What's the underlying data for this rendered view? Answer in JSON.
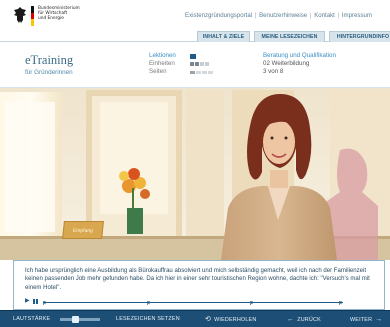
{
  "header": {
    "ministry_lines": [
      "Bundesministerium",
      "für Wirtschaft",
      "und Energie"
    ],
    "topnav": [
      "Existenzgründungsportal",
      "Benutzerhinweise",
      "Kontakt",
      "Impressum"
    ],
    "topnav_separator": "|"
  },
  "tabs": [
    {
      "label": "INHALT & ZIELE"
    },
    {
      "label": "MEINE LESEZEICHEN"
    },
    {
      "label": "HINTERGRUNDINFO"
    }
  ],
  "info": {
    "brand_title": "eTraining",
    "brand_subtitle": "für Gründerinnen",
    "stats": [
      {
        "label": "Lektionen",
        "progress_on": 1,
        "progress_total": 1
      },
      {
        "label": "Einheiten",
        "progress_on": 2,
        "progress_total": 4
      },
      {
        "label": "Seiten",
        "progress_on": 1,
        "progress_total": 4
      }
    ],
    "course_title": "Beratung und Qualifikation",
    "course_line1": "02 Weiterbildung",
    "course_line2": "3 von 8"
  },
  "scene": {
    "reception_sign": "Empfang"
  },
  "caption": {
    "text": "Ich habe ursprünglich eine Ausbildung als Bürokauffrau absolviert und mich selbständig gemacht, weil ich nach der Familienzeit keinen passenden Job mehr gefunden habe. Da ich hier in einer sehr touristischen Region wohne, dachte ich: \"Versuch's mal mit einem Hotel\".",
    "markers": [
      "F",
      "F",
      "F",
      "F"
    ]
  },
  "controls": {
    "volume_label": "LAUTSTÄRKE",
    "bookmark_label": "LESEZEICHEN SETZEN",
    "repeat_label": "WIEDERHOLEN",
    "back_label": "ZURÜCK",
    "next_label": "WEITER"
  },
  "colors": {
    "brand_blue": "#1d4f76",
    "link_blue": "#3a8fc7",
    "tab_bg": "#d7e4ec"
  }
}
